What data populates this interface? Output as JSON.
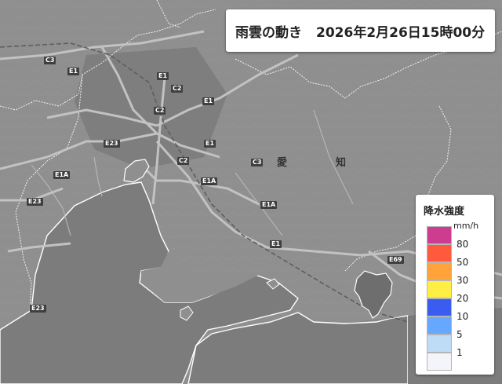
{
  "header": {
    "title": "雨雲の動き",
    "timestamp": "2026年2月26日15時00分"
  },
  "legend": {
    "title": "降水強度",
    "unit": "mm/h",
    "levels": [
      {
        "label": "80",
        "color": "#cc3d8f"
      },
      {
        "label": "50",
        "color": "#ff5a3c"
      },
      {
        "label": "30",
        "color": "#ffa33a"
      },
      {
        "label": "20",
        "color": "#ffee44"
      },
      {
        "label": "10",
        "color": "#3a5cf0"
      },
      {
        "label": "5",
        "color": "#66a8ff"
      },
      {
        "label": "1",
        "color": "#bfdcf6"
      },
      {
        "label": "",
        "color": "#f3f5fb"
      }
    ]
  },
  "map": {
    "place_labels": {
      "ai": "愛",
      "chi": "知"
    },
    "road_signs": [
      "C3",
      "E1",
      "E1",
      "C2",
      "C2",
      "E23",
      "E1A",
      "E1",
      "C3",
      "E1A",
      "E1",
      "E69",
      "E23",
      "E23",
      "E1A",
      "C2",
      "E1"
    ]
  }
}
